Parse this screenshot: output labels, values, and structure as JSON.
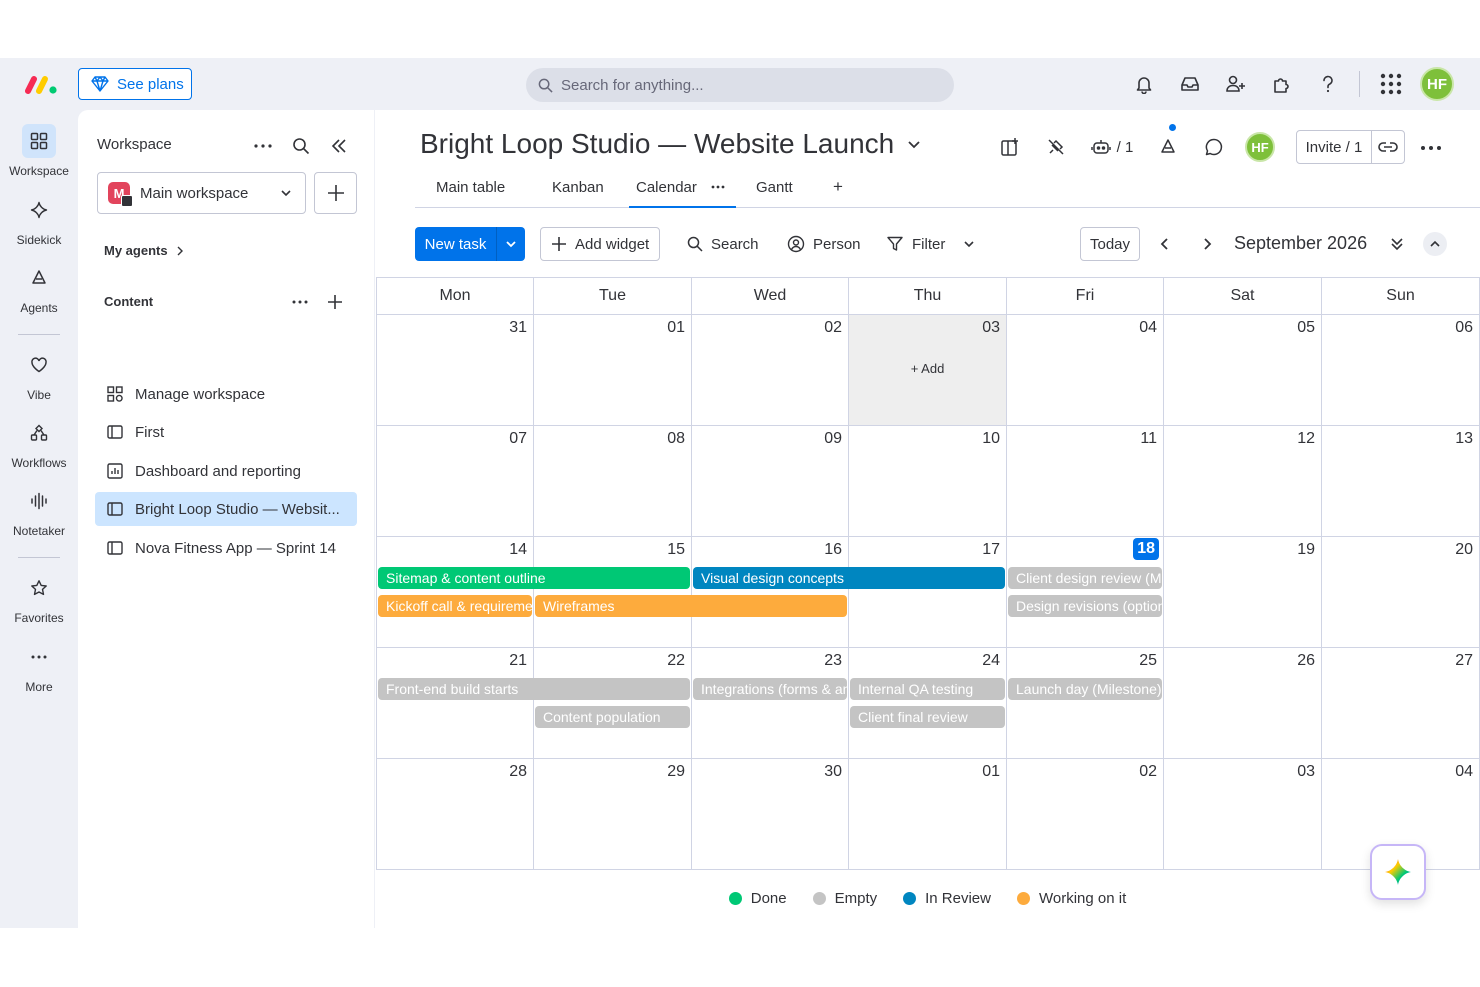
{
  "topbar": {
    "see_plans": "See plans",
    "search_placeholder": "Search for anything...",
    "avatar": "HF"
  },
  "rail": {
    "items": [
      {
        "label": "Workspace",
        "icon": "grid-icon"
      },
      {
        "label": "Sidekick",
        "icon": "sparkle-icon"
      },
      {
        "label": "Agents",
        "icon": "agent-icon"
      },
      {
        "label": "Vibe",
        "icon": "heart-icon"
      },
      {
        "label": "Workflows",
        "icon": "workflows-icon"
      },
      {
        "label": "Notetaker",
        "icon": "waveform-icon"
      },
      {
        "label": "Favorites",
        "icon": "star-icon"
      },
      {
        "label": "More",
        "icon": "dots-icon"
      }
    ]
  },
  "sidebar": {
    "title": "Workspace",
    "workspace_name": "Main workspace",
    "workspace_initial": "M",
    "my_agents": "My agents",
    "content_label": "Content",
    "items": [
      {
        "label": "Manage workspace"
      },
      {
        "label": "First"
      },
      {
        "label": "Dashboard and reporting"
      },
      {
        "label": "Bright Loop Studio — Websit..."
      },
      {
        "label": "Nova Fitness App — Sprint 14"
      }
    ]
  },
  "board": {
    "title": "Bright Loop Studio — Website Launch",
    "automations_count": "/ 1",
    "avatar": "HF",
    "invite": "Invite / 1",
    "tabs": [
      {
        "label": "Main table"
      },
      {
        "label": "Kanban"
      },
      {
        "label": "Calendar"
      },
      {
        "label": "Gantt"
      },
      {
        "label": "+"
      }
    ]
  },
  "toolbar": {
    "new_task": "New task",
    "add_widget": "Add widget",
    "search": "Search",
    "person": "Person",
    "filter": "Filter",
    "today": "Today",
    "month": "September 2026"
  },
  "calendar": {
    "weekdays": [
      "Mon",
      "Tue",
      "Wed",
      "Thu",
      "Fri",
      "Sat",
      "Sun"
    ],
    "weeks": [
      [
        "31",
        "01",
        "02",
        "03",
        "04",
        "05",
        "06"
      ],
      [
        "07",
        "08",
        "09",
        "10",
        "11",
        "12",
        "13"
      ],
      [
        "14",
        "15",
        "16",
        "17",
        "18",
        "19",
        "20"
      ],
      [
        "21",
        "22",
        "23",
        "24",
        "25",
        "26",
        "27"
      ],
      [
        "28",
        "29",
        "30",
        "01",
        "02",
        "03",
        "04"
      ]
    ],
    "today": "18",
    "add_hint": "+ Add",
    "events": [
      {
        "title": "Sitemap & content outline",
        "status": "Done",
        "color": "#00c875"
      },
      {
        "title": "Kickoff call & requirements",
        "status": "Working on it",
        "color": "#fdab3d"
      },
      {
        "title": "Wireframes",
        "status": "Working on it",
        "color": "#fdab3d"
      },
      {
        "title": "Visual design concepts",
        "status": "In Review",
        "color": "#0086c0"
      },
      {
        "title": "Client design review (Milestone)",
        "status": "Empty",
        "color": "#c4c4c4"
      },
      {
        "title": "Design revisions (optional)",
        "status": "Empty",
        "color": "#c4c4c4"
      },
      {
        "title": "Front-end build starts",
        "status": "Empty",
        "color": "#c4c4c4"
      },
      {
        "title": "Content population",
        "status": "Empty",
        "color": "#c4c4c4"
      },
      {
        "title": "Integrations (forms & analytics)",
        "status": "Empty",
        "color": "#c4c4c4"
      },
      {
        "title": "Internal QA testing",
        "status": "Empty",
        "color": "#c4c4c4"
      },
      {
        "title": "Client final review",
        "status": "Empty",
        "color": "#c4c4c4"
      },
      {
        "title": "Launch day (Milestone)",
        "status": "Empty",
        "color": "#c4c4c4"
      }
    ]
  },
  "legend": [
    {
      "label": "Done",
      "color": "#00c875"
    },
    {
      "label": "Empty",
      "color": "#c4c4c4"
    },
    {
      "label": "In Review",
      "color": "#0086c0"
    },
    {
      "label": "Working on it",
      "color": "#fdab3d"
    }
  ]
}
